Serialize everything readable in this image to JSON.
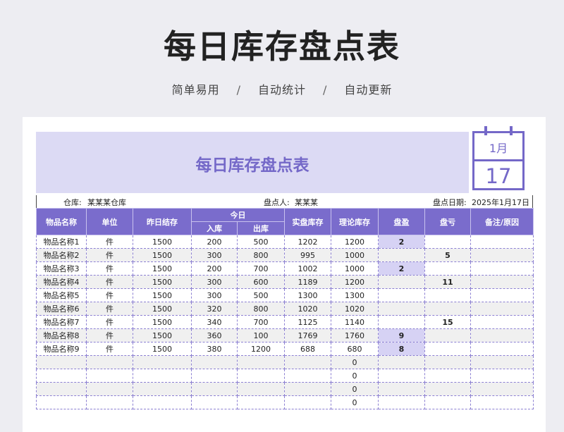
{
  "page": {
    "title": "每日库存盘点表",
    "subtitle_items": [
      "简单易用",
      "自动统计",
      "自动更新"
    ],
    "subtitle_sep": "/"
  },
  "sheet": {
    "banner_title": "每日库存盘点表",
    "calendar": {
      "month": "1月",
      "day": "17"
    },
    "info": {
      "warehouse_label": "仓库:",
      "warehouse_value": "某某某仓库",
      "checker_label": "盘点人:",
      "checker_value": "某某某",
      "date_label": "盘点日期:",
      "date_value": "2025年1月17日"
    },
    "columns": {
      "name": "物品名称",
      "unit": "单位",
      "yesterday": "昨日结存",
      "today": "今日",
      "in": "入库",
      "out": "出库",
      "actual": "实盘库存",
      "theory": "理论库存",
      "gain": "盘盈",
      "loss": "盘亏",
      "note": "备注/原因"
    },
    "rows": [
      {
        "name": "物品名称1",
        "unit": "件",
        "yesterday": "1500",
        "in": "200",
        "out": "500",
        "actual": "1202",
        "theory": "1200",
        "gain": "2",
        "loss": "",
        "note": ""
      },
      {
        "name": "物品名称2",
        "unit": "件",
        "yesterday": "1500",
        "in": "300",
        "out": "800",
        "actual": "995",
        "theory": "1000",
        "gain": "",
        "loss": "5",
        "note": ""
      },
      {
        "name": "物品名称3",
        "unit": "件",
        "yesterday": "1500",
        "in": "200",
        "out": "700",
        "actual": "1002",
        "theory": "1000",
        "gain": "2",
        "loss": "",
        "note": ""
      },
      {
        "name": "物品名称4",
        "unit": "件",
        "yesterday": "1500",
        "in": "300",
        "out": "600",
        "actual": "1189",
        "theory": "1200",
        "gain": "",
        "loss": "11",
        "note": ""
      },
      {
        "name": "物品名称5",
        "unit": "件",
        "yesterday": "1500",
        "in": "300",
        "out": "500",
        "actual": "1300",
        "theory": "1300",
        "gain": "",
        "loss": "",
        "note": ""
      },
      {
        "name": "物品名称6",
        "unit": "件",
        "yesterday": "1500",
        "in": "320",
        "out": "800",
        "actual": "1020",
        "theory": "1020",
        "gain": "",
        "loss": "",
        "note": ""
      },
      {
        "name": "物品名称7",
        "unit": "件",
        "yesterday": "1500",
        "in": "340",
        "out": "700",
        "actual": "1125",
        "theory": "1140",
        "gain": "",
        "loss": "15",
        "note": ""
      },
      {
        "name": "物品名称8",
        "unit": "件",
        "yesterday": "1500",
        "in": "360",
        "out": "100",
        "actual": "1769",
        "theory": "1760",
        "gain": "9",
        "loss": "",
        "note": ""
      },
      {
        "name": "物品名称9",
        "unit": "件",
        "yesterday": "1500",
        "in": "380",
        "out": "1200",
        "actual": "688",
        "theory": "680",
        "gain": "8",
        "loss": "",
        "note": ""
      },
      {
        "name": "",
        "unit": "",
        "yesterday": "",
        "in": "",
        "out": "",
        "actual": "",
        "theory": "0",
        "gain": "",
        "loss": "",
        "note": ""
      },
      {
        "name": "",
        "unit": "",
        "yesterday": "",
        "in": "",
        "out": "",
        "actual": "",
        "theory": "0",
        "gain": "",
        "loss": "",
        "note": ""
      },
      {
        "name": "",
        "unit": "",
        "yesterday": "",
        "in": "",
        "out": "",
        "actual": "",
        "theory": "0",
        "gain": "",
        "loss": "",
        "note": ""
      },
      {
        "name": "",
        "unit": "",
        "yesterday": "",
        "in": "",
        "out": "",
        "actual": "",
        "theory": "0",
        "gain": "",
        "loss": "",
        "note": ""
      }
    ],
    "colors": {
      "accent": "#7a6ccc",
      "banner": "#dcdaf4",
      "highlight": "#d6d2f4"
    }
  }
}
